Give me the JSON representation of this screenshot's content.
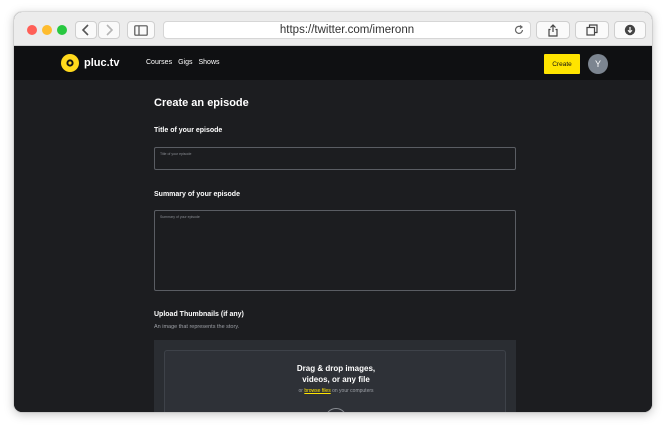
{
  "browser": {
    "url": "https://twitter.com/imeronn"
  },
  "nav": {
    "brand": "pluc.tv",
    "links": [
      "Courses",
      "Gigs",
      "Shows"
    ],
    "create_label": "Create",
    "avatar_initial": "Y",
    "accent_color": "#ffe400"
  },
  "form": {
    "page_title": "Create an episode",
    "title_label": "Title of your episode",
    "title_placeholder": "Title of your episode",
    "summary_label": "Summary of your episode",
    "summary_placeholder": "Summary of your episode",
    "upload_label": "Upload Thumbnails (if any)",
    "upload_sublabel": "An image that represents the story.",
    "drop_title_line1": "Drag & drop images,",
    "drop_title_line2": "videos, or any file",
    "drop_or": "or",
    "browse_label": "browse files",
    "drop_suffix": "on your computers"
  }
}
